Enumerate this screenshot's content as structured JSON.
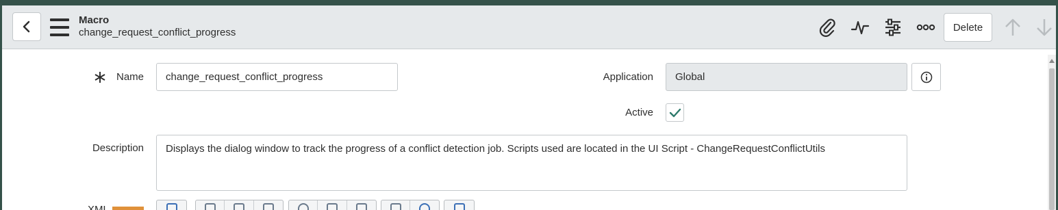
{
  "header": {
    "record_type": "Macro",
    "record_name": "change_request_conflict_progress",
    "icons": [
      "back-icon",
      "menu-icon",
      "attachment-icon",
      "activity-icon",
      "settings-sliders-icon",
      "more-options-icon",
      "arrow-up-icon",
      "arrow-down-icon"
    ],
    "delete_label": "Delete"
  },
  "form": {
    "name_label": "Name",
    "name_value": "change_request_conflict_progress",
    "application_label": "Application",
    "application_value": "Global",
    "active_label": "Active",
    "active_checked": true,
    "description_label": "Description",
    "description_value": "Displays the dialog window to track the progress of a conflict detection job. Scripts used are located in the UI Script - ChangeRequestConflictUtils",
    "xml_label": "XML"
  },
  "colors": {
    "accent": "#35524a",
    "header_bg": "#e6e9eb",
    "readonly_bg": "#e6e9eb",
    "check": "#2d7a6b",
    "xml_badge": "#e0913a"
  }
}
